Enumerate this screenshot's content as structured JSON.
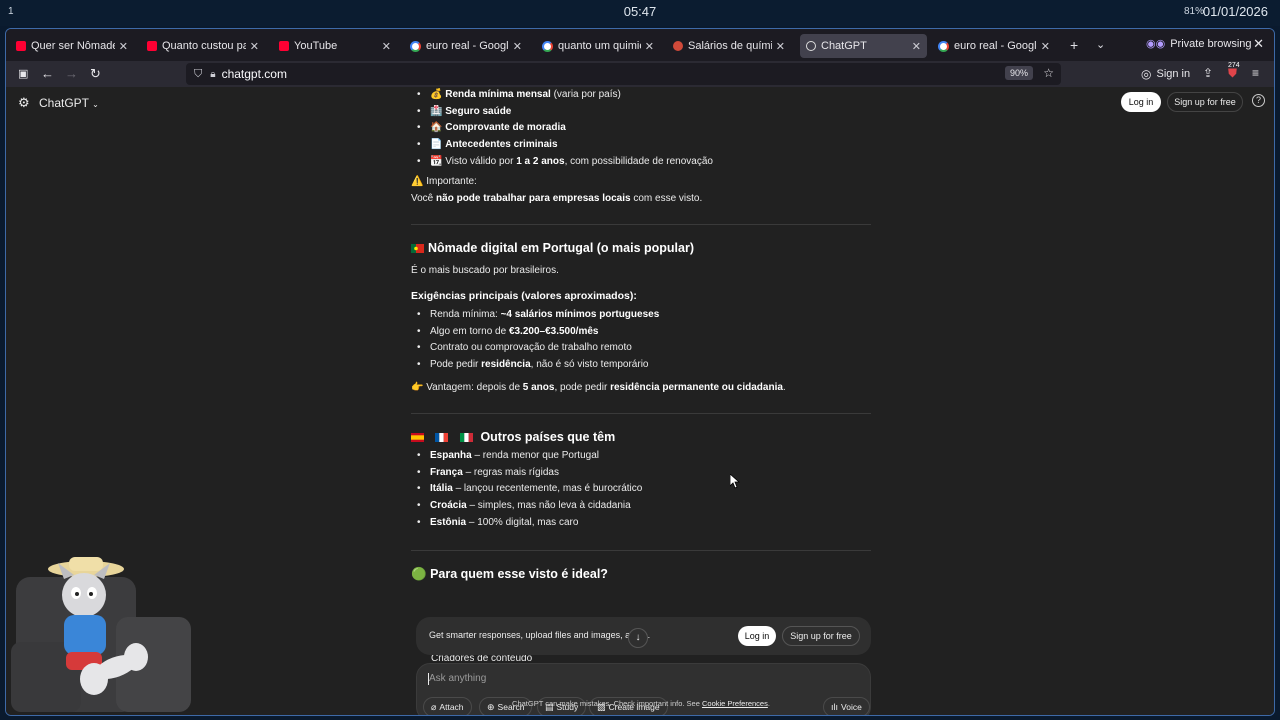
{
  "system": {
    "workspace": "1",
    "clock": "05:47",
    "battery": "81%",
    "date": "01/01/2026"
  },
  "tabs": [
    {
      "label": "Quer ser Nômade D",
      "icon": "youtube-icon"
    },
    {
      "label": "Quanto custou para",
      "icon": "youtube-icon"
    },
    {
      "label": "YouTube",
      "icon": "youtube-icon"
    },
    {
      "label": "euro real - Google Z",
      "icon": "google-icon"
    },
    {
      "label": "quanto um quimico",
      "icon": "google-icon"
    },
    {
      "label": "Salários de químicos",
      "icon": "site-icon"
    },
    {
      "label": "ChatGPT",
      "icon": "chatgpt-icon",
      "active": true
    },
    {
      "label": "euro real - Google Z",
      "icon": "google-icon"
    }
  ],
  "browser": {
    "private_label": "Private browsing",
    "url": "chatgpt.com",
    "zoom": "90%",
    "sign_in": "Sign in",
    "badge": "274"
  },
  "header": {
    "title": "ChatGPT",
    "login": "Log in",
    "signup": "Sign up for free",
    "help": "?"
  },
  "section_top": {
    "items": [
      {
        "emoji": "💰",
        "bold": "Renda mínima mensal",
        "rest": " (varia por país)"
      },
      {
        "emoji": "🏥",
        "bold": "Seguro saúde",
        "rest": ""
      },
      {
        "emoji": "🏠",
        "bold": "Comprovante de moradia",
        "rest": ""
      },
      {
        "emoji": "📄",
        "bold": "Antecedentes criminais",
        "rest": ""
      }
    ],
    "last_item": {
      "emoji": "📆",
      "pre": " Visto válido por ",
      "bold": "1 a 2 anos",
      "rest": ", com possibilidade de renovação"
    },
    "important_label": "⚠️ Importante:",
    "important_pre": "Você ",
    "important_bold": "não pode trabalhar para empresas locais",
    "important_rest": " com esse visto."
  },
  "section_portugal": {
    "title": "Nômade digital em Portugal (o mais popular)",
    "intro": "É o mais buscado por brasileiros.",
    "subtitle": "Exigências principais (valores aproximados):",
    "items": [
      {
        "pre": "Renda mínima: ",
        "bold": "~4 salários mínimos portugueses",
        "rest": ""
      },
      {
        "pre": "Algo em torno de ",
        "bold": "€3.200–€3.500/mês",
        "rest": ""
      },
      {
        "pre": "Contrato ou comprovação de trabalho remoto",
        "bold": "",
        "rest": ""
      },
      {
        "pre": "Pode pedir ",
        "bold": "residência",
        "rest": ", não é só visto temporário"
      }
    ],
    "advantage_pre": "👉 Vantagem: depois de ",
    "advantage_bold1": "5 anos",
    "advantage_mid": ", pode pedir ",
    "advantage_bold2": "residência permanente ou cidadania",
    "advantage_end": "."
  },
  "section_others": {
    "title": "Outros países que têm",
    "items": [
      {
        "bold": "Espanha",
        "rest": " – renda menor que Portugal"
      },
      {
        "bold": "França",
        "rest": " – regras mais rígidas"
      },
      {
        "bold": "Itália",
        "rest": " – lançou recentemente, mas é burocrático"
      },
      {
        "bold": "Croácia",
        "rest": " – simples, mas não leva à cidadania"
      },
      {
        "bold": "Estônia",
        "rest": " – 100% digital, mas caro"
      }
    ]
  },
  "section_ideal": {
    "emoji": "🟢",
    "title": "Para quem esse visto é ideal?",
    "peek": "Criadores de conteúdo"
  },
  "banner": {
    "text": "Get smarter responses, upload files and images, and",
    "text_end": "e.",
    "login": "Log in",
    "signup": "Sign up for free"
  },
  "composer": {
    "placeholder": "Ask anything",
    "chips": {
      "attach": "Attach",
      "search": "Search",
      "study": "Study",
      "create": "Create image",
      "voice": "Voice"
    }
  },
  "footer": {
    "text": "ChatGPT can make mistakes. Check important info. See ",
    "link": "Cookie Preferences",
    "end": "."
  },
  "colors": {
    "page_bg": "#212121",
    "composer_bg": "#303030",
    "accent_green": "#2fb344",
    "private_purple": "#b39cff"
  }
}
